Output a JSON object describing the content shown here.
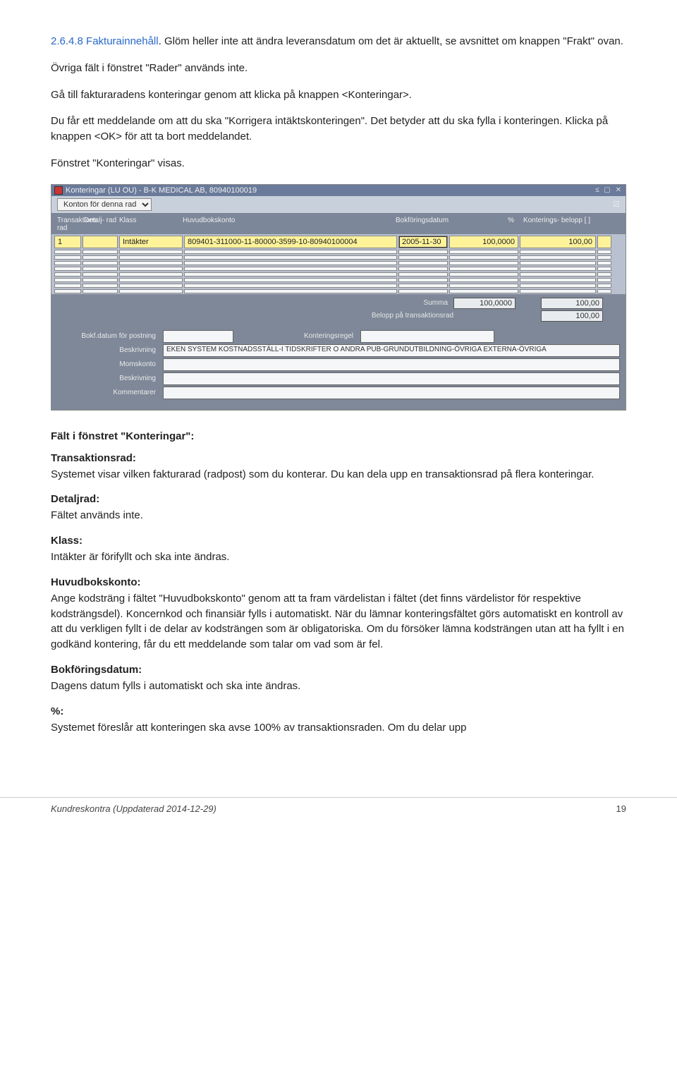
{
  "intro": {
    "link_heading": "2.6.4.8 Fakturainnehåll",
    "p1_suffix": ". Glöm heller inte att ändra leveransdatum om det är aktuellt, se avsnittet om knappen \"Frakt\" ovan.",
    "p2": "Övriga fält i fönstret \"Rader\" används inte.",
    "p3": "Gå till fakturaradens konteringar genom att klicka på knappen <Konteringar>.",
    "p4": "Du får ett meddelande om att du ska \"Korrigera intäktskonteringen\". Det betyder att du ska fylla i konteringen. Klicka på knappen <OK> för att ta bort meddelandet.",
    "p5": "Fönstret \"Konteringar\" visas."
  },
  "screenshot": {
    "title": "Konteringar (LU OU) - B-K MEDICAL AB, 80940100019",
    "dropdown": "Konton för denna rad",
    "cols": {
      "trad": "Transaktions rad",
      "detalj": "Detalj- rad",
      "klass": "Klass",
      "huvud": "Huvudbokskonto",
      "datum": "Bokföringsdatum",
      "pct": "%",
      "belopp": "Konterings- belopp [ ]"
    },
    "row": {
      "trad": "1",
      "detalj": "",
      "klass": "Intäkter",
      "huvud": "809401-311000-11-80000-3599-10-80940100004",
      "datum": "2005-11-30",
      "pct": "100,0000",
      "belopp": "100,00"
    },
    "summary": {
      "lbl_summa": "Summa",
      "lbl_belopp": "Belopp på transaktionsrad",
      "v_summa_pct": "100,0000",
      "v_summa_bel": "100,00",
      "v_trans_bel": "100,00"
    },
    "details": {
      "lbl_bokf": "Bokf.datum för postning",
      "lbl_beskr": "Beskrivning",
      "lbl_moms": "Momskonto",
      "lbl_beskr2": "Beskrivning",
      "lbl_komm": "Kommentarer",
      "lbl_regel": "Konteringsregel",
      "val_beskr": "EKEN SYSTEM KOSTNADSSTÄLL-I TIDSKRIFTER O ANDRA PUB-GRUNDUTBILDNING-ÖVRIGA EXTERNA-ÖVRIGA"
    }
  },
  "fields_section": {
    "heading": "Fält i fönstret \"Konteringar\":",
    "trans": {
      "h": "Transaktionsrad:",
      "t": "Systemet visar vilken fakturarad (radpost) som du konterar. Du kan dela upp en transaktionsrad på flera konteringar."
    },
    "detalj": {
      "h": "Detaljrad:",
      "t": "Fältet används inte."
    },
    "klass": {
      "h": "Klass:",
      "t": "Intäkter är förifyllt och ska inte ändras."
    },
    "huvud": {
      "h": "Huvudbokskonto:",
      "t": "Ange kodsträng i fältet \"Huvudbokskonto\" genom att ta fram värdelistan i fältet (det finns värdelistor för respektive kodsträngsdel). Koncernkod och finansiär fylls i automatiskt. När du lämnar konteringsfältet görs automatiskt en kontroll av att du verkligen fyllt i de delar av kodsträngen som är obligatoriska. Om du försöker lämna kodsträngen utan att ha fyllt i en godkänd kontering, får du ett meddelande som talar om vad som är fel."
    },
    "bokdat": {
      "h": "Bokföringsdatum:",
      "t": "Dagens datum fylls i automatiskt och ska inte ändras."
    },
    "pct": {
      "h": "%:",
      "t": "Systemet föreslår att konteringen ska avse 100% av transaktionsraden. Om du delar upp"
    }
  },
  "footer": {
    "doc": "Kundreskontra (Uppdaterad 2014-12-29)",
    "page": "19"
  }
}
